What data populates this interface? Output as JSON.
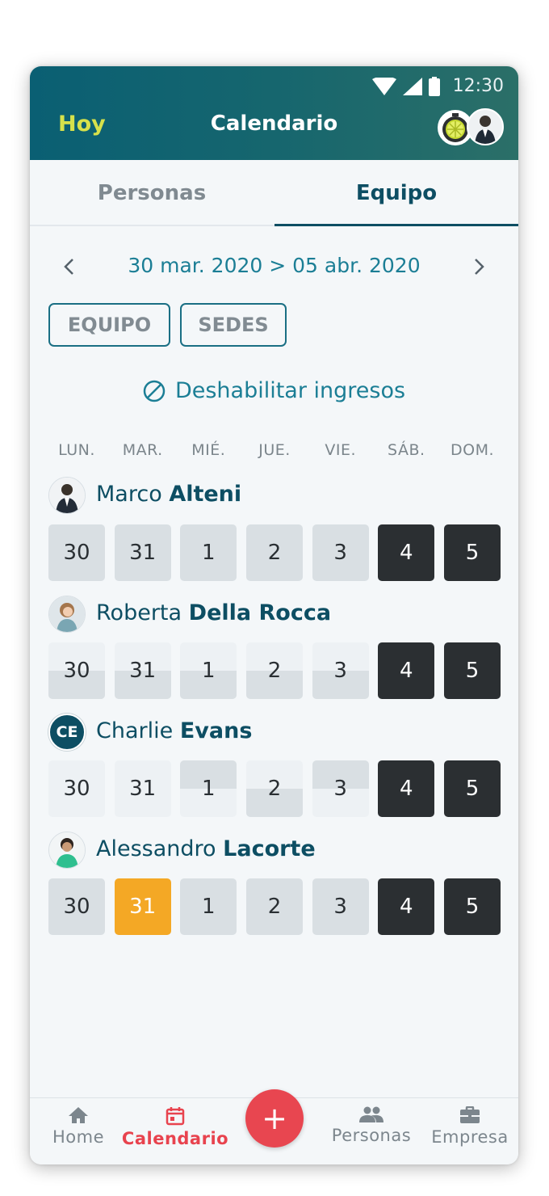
{
  "status_bar": {
    "time": "12:30"
  },
  "header": {
    "today_label": "Hoy",
    "title": "Calendario"
  },
  "tabs": [
    {
      "label": "Personas",
      "active": false
    },
    {
      "label": "Equipo",
      "active": true
    }
  ],
  "date_nav": {
    "range": "30 mar. 2020 > 05 abr. 2020"
  },
  "filters": {
    "team_label": "EQUIPO",
    "sites_label": "SEDES"
  },
  "disable_action": {
    "label": "Deshabilitar ingresos"
  },
  "weekdays": [
    "LUN.",
    "MAR.",
    "MIÉ.",
    "JUE.",
    "VIE.",
    "SÁB.",
    "DOM."
  ],
  "people": [
    {
      "first": "Marco",
      "last": "Alteni",
      "initials": "",
      "days": [
        "30",
        "31",
        "1",
        "2",
        "3",
        "4",
        "5"
      ]
    },
    {
      "first": "Roberta",
      "last": "Della Rocca",
      "initials": "",
      "days": [
        "30",
        "31",
        "1",
        "2",
        "3",
        "4",
        "5"
      ]
    },
    {
      "first": "Charlie",
      "last": "Evans",
      "initials": "CE",
      "days": [
        "30",
        "31",
        "1",
        "2",
        "3",
        "4",
        "5"
      ]
    },
    {
      "first": "Alessandro",
      "last": "Lacorte",
      "initials": "",
      "days": [
        "30",
        "31",
        "1",
        "2",
        "3",
        "4",
        "5"
      ]
    }
  ],
  "bottom_nav": [
    {
      "label": "Home",
      "icon": "home-icon",
      "active": false
    },
    {
      "label": "Calendario",
      "icon": "calendar-icon",
      "active": true
    },
    {
      "label": "Personas",
      "icon": "people-icon",
      "active": false
    },
    {
      "label": "Empresa",
      "icon": "briefcase-icon",
      "active": false
    }
  ],
  "fab": {
    "label": "+"
  },
  "colors": {
    "primary": "#0d4e63",
    "accent": "#e84650",
    "highlight": "#f4a825",
    "weekend": "#2b2f32"
  }
}
